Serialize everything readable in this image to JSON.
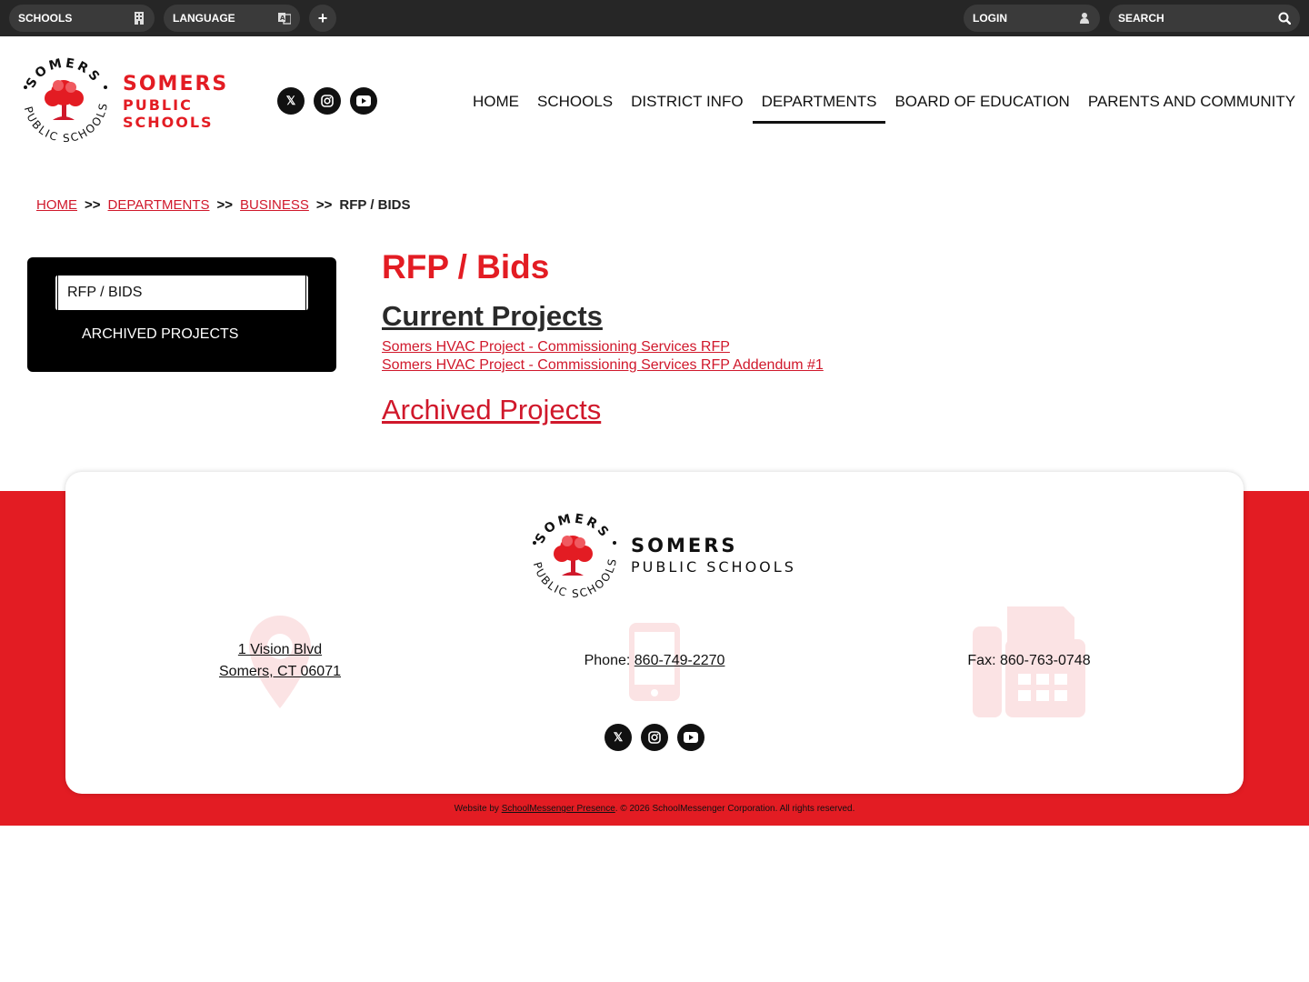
{
  "topbar": {
    "schools_label": "SCHOOLS",
    "language_label": "LANGUAGE",
    "plus_label": "+",
    "login_label": "LOGIN",
    "search_label": "SEARCH"
  },
  "brand": {
    "arc_top": "SOMERS",
    "arc_bottom": "PUBLIC SCHOOLS",
    "line1": "SOMERS",
    "line2": "PUBLIC",
    "line3": "SCHOOLS",
    "accent_color": "#e31c23"
  },
  "social": [
    {
      "name": "x-icon",
      "glyph": "𝕏"
    },
    {
      "name": "instagram-icon",
      "glyph": "◎"
    },
    {
      "name": "youtube-icon",
      "glyph": "▶"
    }
  ],
  "nav": {
    "items": [
      "HOME",
      "SCHOOLS",
      "DISTRICT INFO",
      "DEPARTMENTS",
      "BOARD OF EDUCATION",
      "PARENTS AND COMMUNITY"
    ],
    "active": "DEPARTMENTS"
  },
  "breadcrumb": {
    "home": "HOME",
    "departments": "DEPARTMENTS",
    "business": "BUSINESS",
    "current": "RFP / BIDS",
    "separator": ">>"
  },
  "sidenav": {
    "active": "RFP / BIDS",
    "archived": "ARCHIVED PROJECTS"
  },
  "main": {
    "title": "RFP / Bids",
    "current_heading": "Current Projects",
    "documents": [
      "Somers HVAC Project - Commissioning Services RFP",
      "Somers HVAC Project - Commissioning Services RFP Addendum #1"
    ],
    "archived_heading": "Archived Projects"
  },
  "footer": {
    "logo_line1": "SOMERS",
    "logo_line2": "PUBLIC SCHOOLS",
    "address_line1": "1 Vision Blvd",
    "address_line2": "Somers, CT 06071",
    "phone_label": "Phone:",
    "phone_number": "860-749-2270",
    "fax_text": "Fax: 860-763-0748",
    "copyright_prefix": "Website by",
    "copyright_link": "SchoolMessenger Presence",
    "copyright_suffix": ". © 2026 SchoolMessenger Corporation. All rights reserved."
  }
}
